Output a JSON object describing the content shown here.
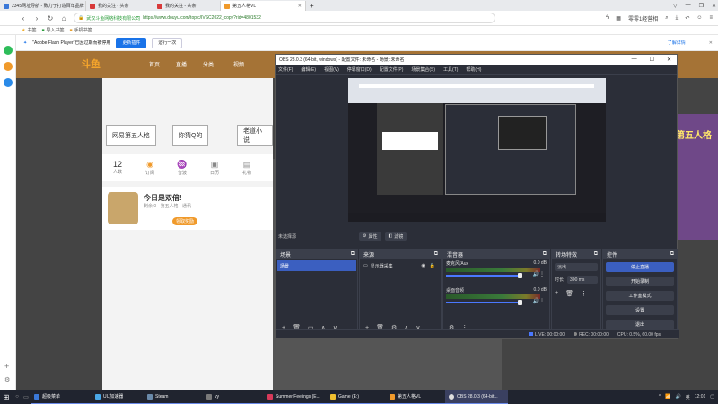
{
  "browser": {
    "tabs": [
      {
        "title": "2345网址导航 - 致力于打造百年品牌",
        "color": "#3a78d8",
        "active": false
      },
      {
        "title": "我的关注 - 头条",
        "color": "#d83a3a",
        "active": false
      },
      {
        "title": "我的关注 - 头条",
        "color": "#d83a3a",
        "active": false
      },
      {
        "title": "第五人格VL",
        "color": "#f09a2b",
        "active": true
      }
    ],
    "new_tab": "+",
    "url_host": "武汉斗鱼网络科技有限公司",
    "url_path": "https://www.douyu.com/topic/IVSC2022_copy?rid=4801532",
    "toolbar_search": "零零1经营相",
    "window_controls": [
      "▽",
      "—",
      "❐",
      "✕"
    ]
  },
  "bookmarks": [
    {
      "label": "书签",
      "icon": "star-icon"
    },
    {
      "label": "导入书签",
      "icon": "import-icon"
    },
    {
      "label": "手机书签",
      "icon": "phone-icon"
    }
  ],
  "flash_bar": {
    "message": "\"Adobe Flash Player\"已因过期而被停用",
    "update_btn": "更新插件",
    "run_once_btn": "运行一次",
    "more_link": "了解详情"
  },
  "site": {
    "logo": "斗鱼",
    "nav": [
      "首页",
      "直播",
      "分类",
      "视频"
    ],
    "hot_tags": [
      "网易第五人格",
      "你猜Q的",
      "老道小说"
    ],
    "stats": [
      {
        "num": "12",
        "label": "人数"
      },
      {
        "num": "",
        "label": "订阅"
      },
      {
        "num": "",
        "label": "音波"
      },
      {
        "num": "",
        "label": "日历"
      },
      {
        "num": "",
        "label": "礼物"
      }
    ],
    "promo_title": "今日是双倍!",
    "promo_sub": "剩余:0 · 第五人格 · 通讯",
    "promo_btn": "领取奖励",
    "ad_text": "第五人格"
  },
  "obs": {
    "title": "OBS 28.0.3 (64-bit, windows) - 配置文件: 未命名 - 场景: 未命名",
    "menu": [
      "文件(F)",
      "编辑(E)",
      "视图(V)",
      "停靠窗口(D)",
      "配置文件(P)",
      "场景集合(S)",
      "工具(T)",
      "帮助(H)"
    ],
    "source_bar": {
      "label": "未选择源",
      "props": "属性",
      "filters": "滤镜"
    },
    "scenes": {
      "title": "场景",
      "items": [
        "场景"
      ]
    },
    "sources": {
      "title": "来源",
      "items": [
        "显示器采集"
      ]
    },
    "mixer": {
      "title": "混音器",
      "rows": [
        {
          "name": "麦克风/Aux",
          "db": "0.0 dB"
        },
        {
          "name": "桌面音频",
          "db": "0.0 dB"
        }
      ]
    },
    "transitions": {
      "title": "转场特效",
      "type": "淡出",
      "duration_label": "时长",
      "duration": "300 ms"
    },
    "controls": {
      "title": "控件",
      "buttons": [
        "停止直播",
        "开始录制",
        "工作室模式",
        "设置",
        "退出"
      ]
    },
    "status": {
      "live": "LIVE: 00:00:00",
      "rec": "REC: 00:00:00",
      "cpu": "CPU: 0.5%, 60.00 fps"
    }
  },
  "taskbar": {
    "start": "⊞",
    "items": [
      {
        "label": "超级菜单",
        "color": "#3a78d8",
        "active": false
      },
      {
        "label": "UU加速器",
        "color": "#4aa8e8",
        "active": false
      },
      {
        "label": "Steam",
        "color": "#1b2838",
        "active": false
      },
      {
        "label": "vy",
        "color": "#7a7a7a",
        "active": false
      },
      {
        "label": "Summer Feelings (E...",
        "color": "#d83a5a",
        "active": false
      },
      {
        "label": "Game (E:)",
        "color": "#f0c030",
        "active": false
      },
      {
        "label": "第五人格VL",
        "color": "#f09a2b",
        "active": false
      },
      {
        "label": "OBS 28.0.3 (64-bit...",
        "color": "#444",
        "active": true
      }
    ],
    "tray": [
      "^",
      "英",
      "12:01"
    ]
  }
}
